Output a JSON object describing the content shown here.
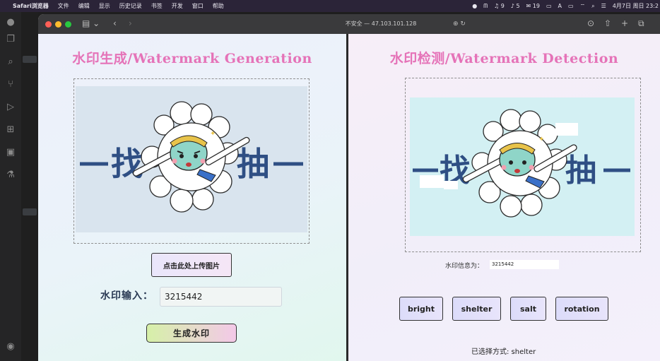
{
  "menubar": {
    "app": "Safari浏览器",
    "items": [
      "文件",
      "编辑",
      "显示",
      "历史记录",
      "书签",
      "开发",
      "窗口",
      "帮助"
    ],
    "status": [
      "9",
      "5",
      "19",
      "A",
      "4月7日 周日 23:2"
    ]
  },
  "browser": {
    "url": "不安全 — 47.103.101.128"
  },
  "generation": {
    "title": "水印生成/Watermark Generation",
    "upload_label": "点击此处上传图片",
    "input_label": "水印输入：",
    "input_value": "3215442",
    "generate_label": "生成水印",
    "image_text_left": "找",
    "image_text_right": "抽"
  },
  "detection": {
    "title": "水印检测/Watermark Detection",
    "info_label": "水印信息为：",
    "info_value": "3215442",
    "methods": [
      "bright",
      "shelter",
      "salt",
      "rotation"
    ],
    "selected_label": "已选择方式: shelter",
    "image_text_left": "找",
    "image_text_right": "抽"
  },
  "colors": {
    "title": "#e573b8",
    "gen_bg": "#d9e4ee",
    "det_bg": "#d3f0f3",
    "text_blue": "#2f4f84"
  }
}
